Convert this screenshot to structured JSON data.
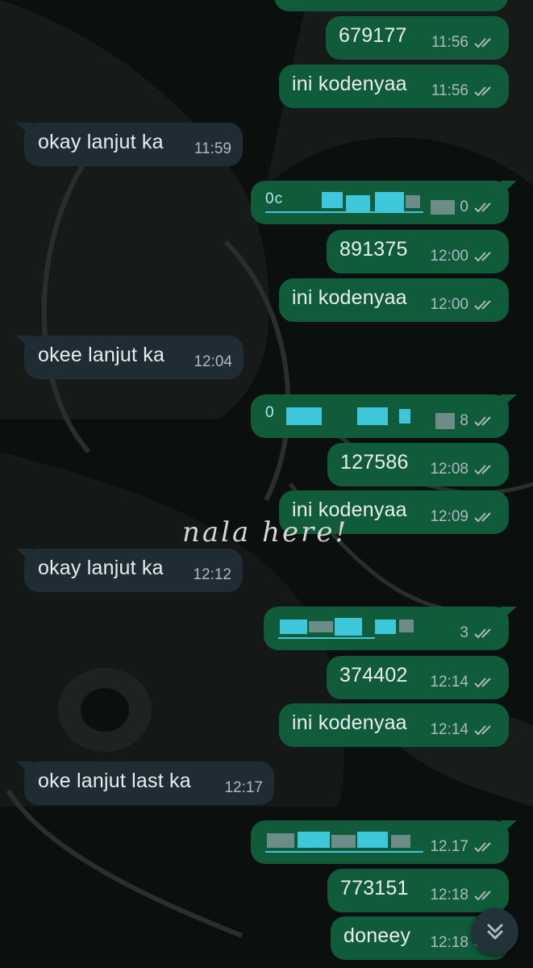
{
  "watermark": "nala here!",
  "messages": [
    {
      "text": "679177",
      "time": "11:56"
    },
    {
      "text": "ini kodenyaa",
      "time": "11:56"
    },
    {
      "text": "okay lanjut ka",
      "time": "11:59"
    },
    {
      "text": "[redacted]",
      "time": "12:00"
    },
    {
      "text": "891375",
      "time": "12:00"
    },
    {
      "text": "ini kodenyaa",
      "time": "12:00"
    },
    {
      "text": "okee lanjut ka",
      "time": "12:04"
    },
    {
      "text": "[redacted]",
      "time": "12:08"
    },
    {
      "text": "127586",
      "time": "12:08"
    },
    {
      "text": "ini kodenyaa",
      "time": "12:09"
    },
    {
      "text": "okay lanjut ka",
      "time": "12:12"
    },
    {
      "text": "[redacted]",
      "time": "3"
    },
    {
      "text": "374402",
      "time": "12:14"
    },
    {
      "text": "ini kodenyaa",
      "time": "12:14"
    },
    {
      "text": "oke lanjut last ka",
      "time": "12:17"
    },
    {
      "text": "[redacted]",
      "time": "12.17"
    },
    {
      "text": "773151",
      "time": "12:18"
    },
    {
      "text": "doneey",
      "time": "12:18"
    }
  ],
  "redacted_fragments": {
    "m3": "0c",
    "m3_time_tail": "0",
    "m7": "0",
    "m7_time_tail": "8"
  },
  "colors": {
    "outgoing_bubble": "#0f5b3a",
    "incoming_bubble": "#1f2c33",
    "meta_text": "#aebac1",
    "redaction": "#3ec6da"
  },
  "icons": {
    "status": "double-check-icon",
    "scroll": "double-chevron-down-icon"
  }
}
